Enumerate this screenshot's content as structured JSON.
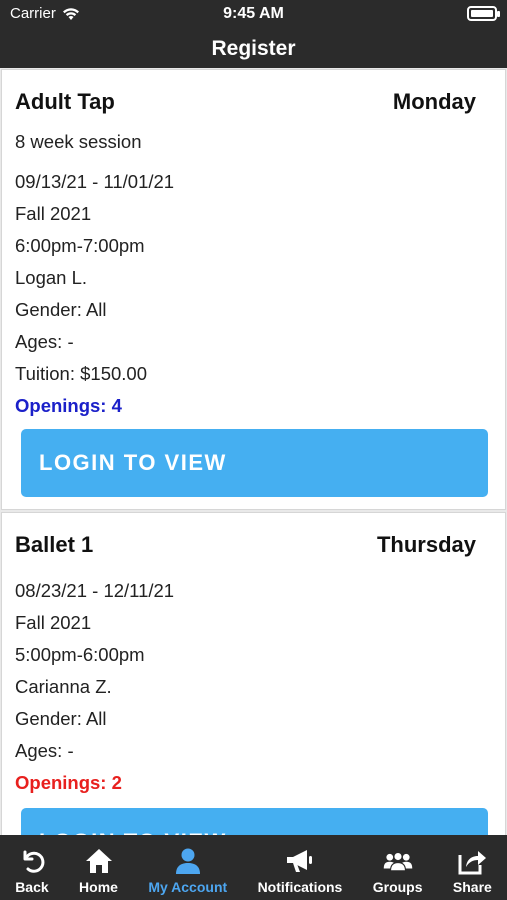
{
  "status": {
    "carrier": "Carrier",
    "time": "9:45 AM",
    "battery_level": 1.0
  },
  "header": {
    "title": "Register"
  },
  "classes": [
    {
      "name": "Adult Tap",
      "day": "Monday",
      "session": "8 week session",
      "dates": "09/13/21 - 11/01/21",
      "term": "Fall 2021",
      "time": "6:00pm-7:00pm",
      "instructor": "Logan L.",
      "gender": "Gender: All",
      "ages": "Ages: -",
      "tuition": "Tuition: $150.00",
      "openings": "Openings: 4",
      "openings_color": "#1b20c9",
      "button_label": "LOGIN TO VIEW"
    },
    {
      "name": "Ballet 1",
      "day": "Thursday",
      "dates": "08/23/21 - 12/11/21",
      "term": "Fall 2021",
      "time": "5:00pm-6:00pm",
      "instructor": "Carianna Z.",
      "gender": "Gender: All",
      "ages": "Ages: -",
      "openings": "Openings: 2",
      "openings_color": "#e8201e",
      "button_label": "LOGIN TO VIEW"
    }
  ],
  "tabbar": {
    "items": [
      {
        "label": "Back",
        "icon": "back-arrow-icon"
      },
      {
        "label": "Home",
        "icon": "home-icon"
      },
      {
        "label": "My Account",
        "icon": "person-icon",
        "active": true
      },
      {
        "label": "Notifications",
        "icon": "megaphone-icon"
      },
      {
        "label": "Groups",
        "icon": "group-icon"
      },
      {
        "label": "Share",
        "icon": "share-icon"
      }
    ]
  },
  "colors": {
    "bar_bg": "#2b2b2b",
    "accent": "#45aff1",
    "active_tab": "#4da6f0"
  }
}
